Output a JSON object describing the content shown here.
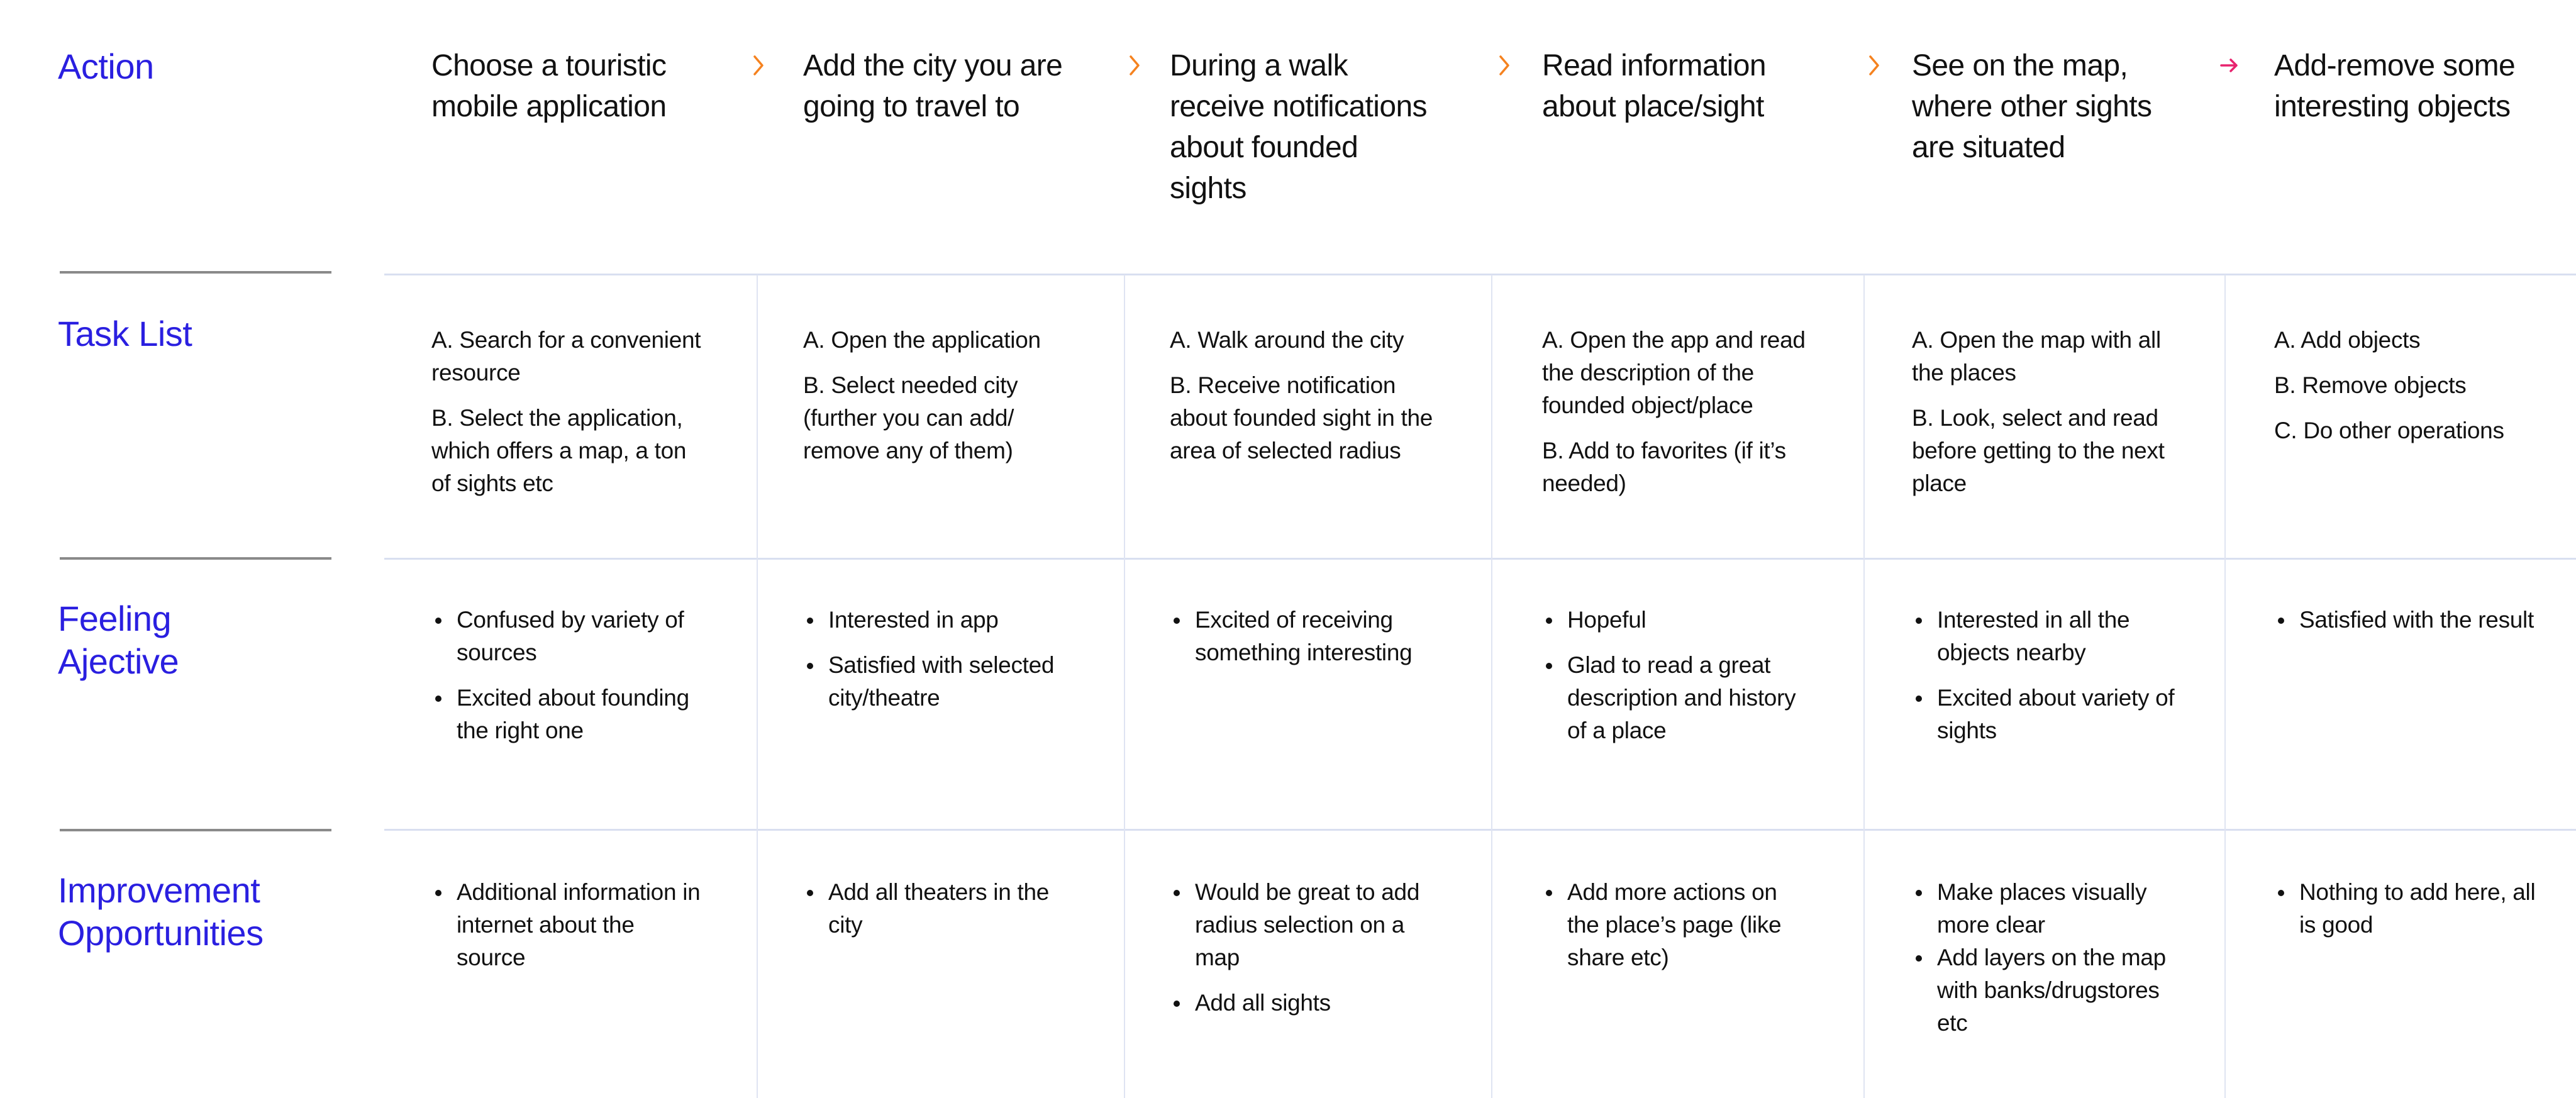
{
  "colors": {
    "label": "#2A1FE0",
    "chevron": "#F5821F",
    "arrow_final": "#E8236E"
  },
  "rows": {
    "action": {
      "label": "Action"
    },
    "task_list": {
      "label": "Task List"
    },
    "feeling": {
      "label_line1": "Feeling",
      "label_line2": "Ajective"
    },
    "improvement": {
      "label_line1": "Improvement",
      "label_line2": "Opportunities"
    }
  },
  "separators": [
    {
      "icon": "chevron-right-icon",
      "glyph": "›"
    },
    {
      "icon": "chevron-right-icon",
      "glyph": "›"
    },
    {
      "icon": "chevron-right-icon",
      "glyph": "›"
    },
    {
      "icon": "chevron-right-icon",
      "glyph": "›"
    },
    {
      "icon": "arrow-right-icon",
      "glyph": "→"
    }
  ],
  "steps": [
    {
      "action": "Choose a touristic mobile application",
      "tasks": [
        "A. Search for a convenient resource",
        "B. Select the application, which offers a map, a ton of sights etc"
      ],
      "feelings": [
        "Confused by variety of sources",
        "Excited about founding the right one"
      ],
      "improvements": [
        "Additional information in internet about the source"
      ]
    },
    {
      "action": "Add the city you are going to travel to",
      "tasks": [
        "A. Open the application",
        "B. Select needed city (further you can add/ remove any of them)"
      ],
      "feelings": [
        "Interested in app",
        "Satisfied with selected city/theatre"
      ],
      "improvements": [
        "Add all theaters in the city"
      ]
    },
    {
      "action": "During a walk receive notifications about founded sights",
      "tasks": [
        "A. Walk around the city",
        "B. Receive notification about founded sight in the area of selected radius"
      ],
      "feelings": [
        "Excited of receiving something interesting"
      ],
      "improvements": [
        "Would be great to add radius selection on a map",
        "Add all sights"
      ]
    },
    {
      "action": "Read information about place/sight",
      "tasks": [
        "A. Open the app and read the description of the founded object/place",
        "B. Add to favorites (if it’s needed)"
      ],
      "feelings": [
        "Hopeful",
        "Glad to read a great description and history of a place"
      ],
      "improvements": [
        "Add more actions on the place’s page (like share etc)"
      ]
    },
    {
      "action": "See on the map, where other sights are situated",
      "tasks": [
        "A. Open the map with all the places",
        "B. Look, select and read before getting to the next place"
      ],
      "feelings": [
        "Interested in all the objects nearby",
        "Excited about variety of sights"
      ],
      "improvements": [
        "Make places visually more clear",
        "Add layers on the map with banks/drugstores etc"
      ]
    },
    {
      "action": "Add-remove some interesting objects",
      "tasks": [
        "A. Add objects",
        "B. Remove objects",
        "C. Do other operations"
      ],
      "feelings": [
        "Satisfied with the result"
      ],
      "improvements": [
        "Nothing to add here, all is good"
      ]
    }
  ]
}
